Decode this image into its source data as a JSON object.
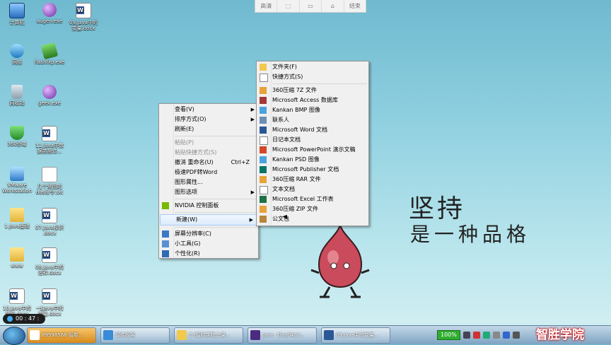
{
  "desktop": {
    "icons": [
      {
        "label": "计算机",
        "icon": "computer-icon"
      },
      {
        "label": "augen.exe",
        "icon": "program-icon"
      },
      {
        "label": "09.Java中的\n变量.docx",
        "icon": "word-doc-icon"
      },
      {
        "label": "网络",
        "icon": "network-icon"
      },
      {
        "label": "flashfxp.exe",
        "icon": "program-icon"
      },
      {
        "label": "回收站",
        "icon": "recycle-bin-icon"
      },
      {
        "label": "geek.exe",
        "icon": "program-icon"
      },
      {
        "label": "360杀毒",
        "icon": "shield-icon"
      },
      {
        "label": "11.Java中数\n据类型转...",
        "icon": "word-doc-icon"
      },
      {
        "label": "VMware\nWorkstation",
        "icon": "vmware-icon"
      },
      {
        "label": "几个常用的\ndos命令.txt",
        "icon": "text-file-icon"
      },
      {
        "label": "1.Java基础",
        "icon": "folder-icon"
      },
      {
        "label": "07.Java标识\n.docx",
        "icon": "word-doc-icon"
      },
      {
        "label": "www",
        "icon": "folder-icon"
      },
      {
        "label": "08.Java中的\n注释.docx",
        "icon": "word-doc-icon"
      },
      {
        "label": "10.Java中的\n常量.docx",
        "icon": "word-doc-icon"
      },
      {
        "label": "~$Java中的\n变量.docx",
        "icon": "word-doc-icon"
      }
    ]
  },
  "toolbar": {
    "items": [
      "高清",
      "⬚",
      "▭",
      "⌂",
      "结束"
    ]
  },
  "context_menu": {
    "items": [
      {
        "label": "查看(V)",
        "submenu": true,
        "disabled": false
      },
      {
        "label": "排序方式(O)",
        "submenu": true,
        "disabled": false
      },
      {
        "label": "刷新(E)",
        "submenu": false,
        "disabled": false
      },
      {
        "sep": true
      },
      {
        "label": "粘贴(P)",
        "disabled": true
      },
      {
        "label": "粘贴快捷方式(S)",
        "disabled": true
      },
      {
        "label": "撤消 重命名(U)",
        "accel": "Ctrl+Z",
        "disabled": false
      },
      {
        "label": "极速PDF转Word",
        "disabled": false
      },
      {
        "label": "图形属性...",
        "disabled": false
      },
      {
        "label": "图形选项",
        "submenu": true,
        "disabled": false
      },
      {
        "sep": true
      },
      {
        "label": "NVIDIA 控制面板",
        "icon": "nvidia-icon",
        "disabled": false
      },
      {
        "sep": true
      },
      {
        "label": "新建(W)",
        "submenu": true,
        "disabled": false,
        "highlight": true
      },
      {
        "sep": true
      },
      {
        "label": "屏幕分辨率(C)",
        "icon": "display-icon",
        "disabled": false
      },
      {
        "label": "小工具(G)",
        "icon": "gadget-icon",
        "disabled": false
      },
      {
        "label": "个性化(R)",
        "icon": "personalize-icon",
        "disabled": false
      }
    ]
  },
  "new_submenu": {
    "items": [
      {
        "label": "文件夹(F)",
        "icon": "folder-icon"
      },
      {
        "label": "快捷方式(S)",
        "icon": "shortcut-icon"
      },
      {
        "sep": true
      },
      {
        "label": "360压缩 7Z 文件",
        "icon": "archive-icon"
      },
      {
        "label": "Microsoft Access 数据库",
        "icon": "access-icon"
      },
      {
        "label": "Kankan BMP 图像",
        "icon": "image-icon"
      },
      {
        "label": "联系人",
        "icon": "contact-icon"
      },
      {
        "label": "Microsoft Word 文档",
        "icon": "word-icon"
      },
      {
        "label": "日记本文档",
        "icon": "journal-icon"
      },
      {
        "label": "Microsoft PowerPoint 演示文稿",
        "icon": "powerpoint-icon"
      },
      {
        "label": "Kankan PSD 图像",
        "icon": "image-icon"
      },
      {
        "label": "Microsoft Publisher 文档",
        "icon": "publisher-icon"
      },
      {
        "label": "360压缩 RAR 文件",
        "icon": "archive-icon"
      },
      {
        "label": "文本文档",
        "icon": "text-icon"
      },
      {
        "label": "Microsoft Excel 工作表",
        "icon": "excel-icon"
      },
      {
        "label": "360压缩 ZIP 文件",
        "icon": "archive-icon"
      },
      {
        "label": "公文包",
        "icon": "briefcase-icon"
      }
    ]
  },
  "slogan": {
    "line1": "坚持",
    "line2": "是一种品格"
  },
  "taskbar": {
    "buttons": [
      {
        "label": "89598568-智胜...",
        "icon": "qq-icon"
      },
      {
        "label": "智胜极客",
        "icon": "app-icon"
      },
      {
        "label": "C:\\智胜学院上课...",
        "icon": "folder-icon"
      },
      {
        "label": "Java - Day04/sr...",
        "icon": "eclipse-icon"
      },
      {
        "label": "09.Java中的变量...",
        "icon": "word-icon"
      }
    ],
    "battery": "100%",
    "timer": "00 : 47 : 32",
    "brand": "智胜学院"
  },
  "colors": {
    "menu_bg": "#f0f0f0",
    "highlight": "#dcebfc",
    "battery": "#2fae2f",
    "brand": "#ffffff"
  }
}
